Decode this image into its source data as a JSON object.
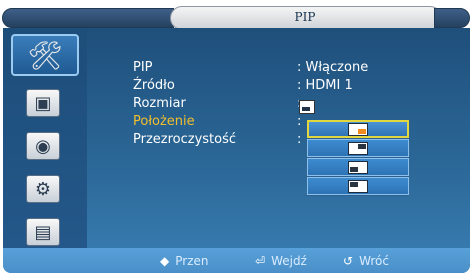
{
  "window": {
    "title": "PIP"
  },
  "sidebar": {
    "items": [
      {
        "icon": "tools-icon"
      },
      {
        "icon": "picture-icon"
      },
      {
        "icon": "sound-icon"
      },
      {
        "icon": "settings-icon"
      },
      {
        "icon": "input-icon"
      }
    ]
  },
  "menu": {
    "rows": [
      {
        "label": "PIP",
        "value": ": Włączone"
      },
      {
        "label": "Źródło",
        "value": ": HDMI 1"
      },
      {
        "label": "Rozmiar",
        "value": ":"
      },
      {
        "label": "Położenie",
        "value": ":"
      },
      {
        "label": "Przezroczystość",
        "value": ":"
      }
    ]
  },
  "position_options": [
    {
      "corner": "bottom-right",
      "selected": true
    },
    {
      "corner": "top-right",
      "selected": false
    },
    {
      "corner": "bottom-left",
      "selected": false
    },
    {
      "corner": "top-left",
      "selected": false
    }
  ],
  "hints": [
    {
      "icon": "◆",
      "label": "Przen"
    },
    {
      "icon": "⏎",
      "label": "Wejdź"
    },
    {
      "icon": "↺",
      "label": "Wróć"
    }
  ],
  "colors": {
    "highlight": "#f4bf2b",
    "panel": "#2b6797"
  }
}
